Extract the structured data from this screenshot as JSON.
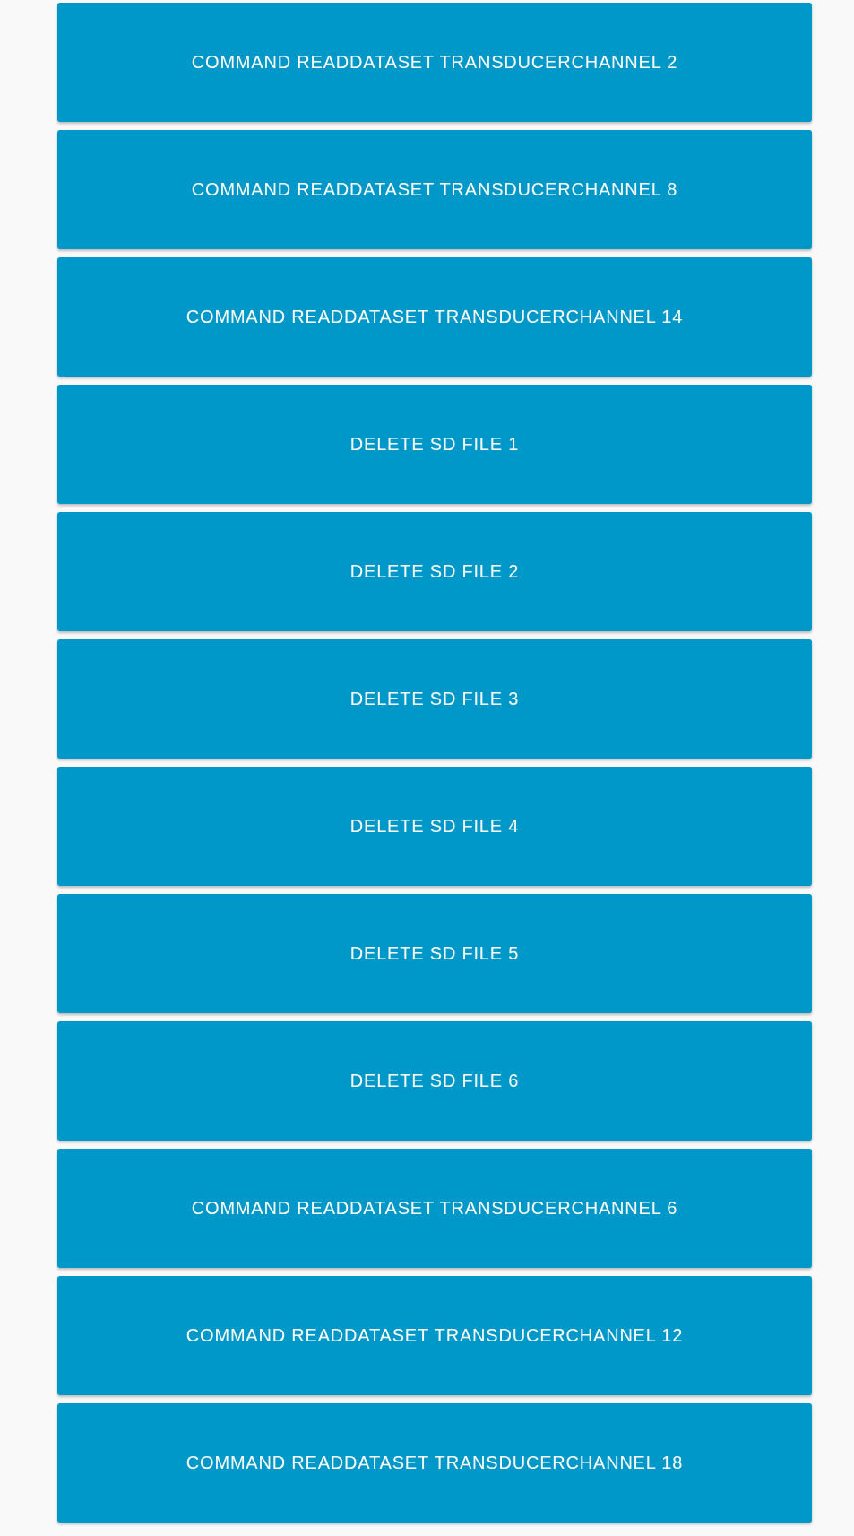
{
  "buttons": [
    {
      "label": "COMMAND READDATASET TRANSDUCERCHANNEL 2"
    },
    {
      "label": "COMMAND READDATASET TRANSDUCERCHANNEL 8"
    },
    {
      "label": "COMMAND READDATASET TRANSDUCERCHANNEL 14"
    },
    {
      "label": "DELETE SD FILE 1"
    },
    {
      "label": "DELETE SD FILE 2"
    },
    {
      "label": "DELETE SD FILE 3"
    },
    {
      "label": "DELETE SD FILE 4"
    },
    {
      "label": "DELETE SD FILE 5"
    },
    {
      "label": "DELETE SD FILE 6"
    },
    {
      "label": "COMMAND READDATASET TRANSDUCERCHANNEL 6"
    },
    {
      "label": "COMMAND READDATASET TRANSDUCERCHANNEL 12"
    },
    {
      "label": "COMMAND READDATASET TRANSDUCERCHANNEL 18"
    }
  ]
}
